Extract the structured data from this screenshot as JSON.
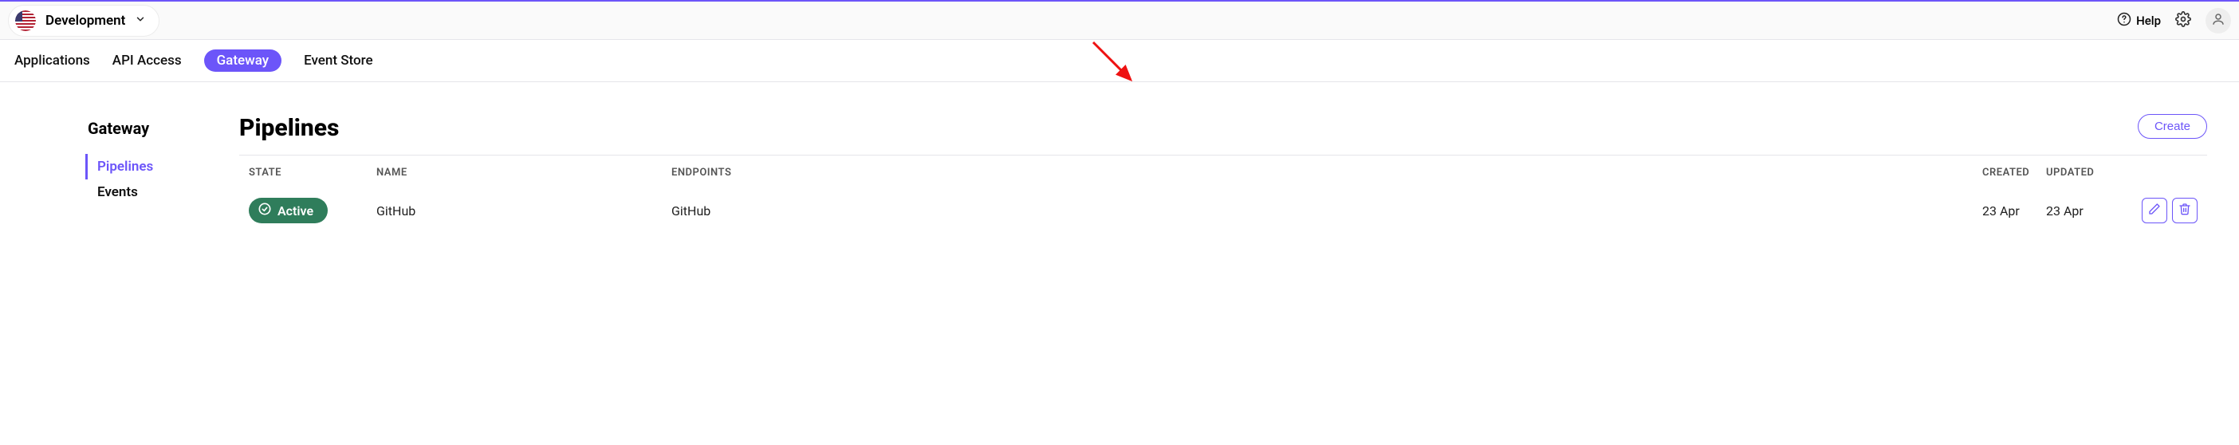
{
  "top": {
    "env_name": "Development",
    "help_label": "Help"
  },
  "tabs": [
    {
      "label": "Applications",
      "active": false
    },
    {
      "label": "API Access",
      "active": false
    },
    {
      "label": "Gateway",
      "active": true
    },
    {
      "label": "Event Store",
      "active": false
    }
  ],
  "sidebar": {
    "title": "Gateway",
    "items": [
      {
        "label": "Pipelines",
        "active": true
      },
      {
        "label": "Events",
        "active": false
      }
    ]
  },
  "page": {
    "title": "Pipelines",
    "create_label": "Create"
  },
  "table": {
    "headers": {
      "state": "STATE",
      "name": "NAME",
      "endpoints": "ENDPOINTS",
      "created": "CREATED",
      "updated": "UPDATED"
    },
    "rows": [
      {
        "state": "Active",
        "name": "GitHub",
        "endpoints": "GitHub",
        "created": "23 Apr",
        "updated": "23 Apr"
      }
    ]
  }
}
